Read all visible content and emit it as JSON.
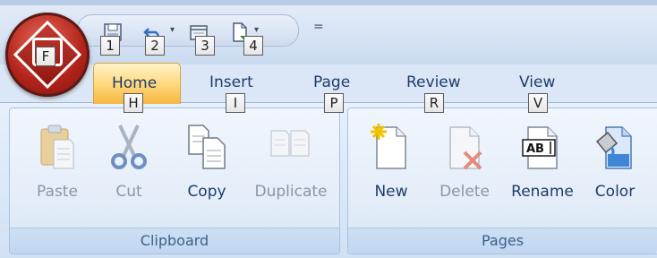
{
  "app_button": {
    "keytip": "F"
  },
  "quick_access": {
    "keytips": [
      "1",
      "2",
      "3",
      "4"
    ],
    "customize_glyph": "="
  },
  "tabs": [
    {
      "label": "Home",
      "keytip": "H"
    },
    {
      "label": "Insert",
      "keytip": "I"
    },
    {
      "label": "Page",
      "keytip": "P"
    },
    {
      "label": "Review",
      "keytip": "R"
    },
    {
      "label": "View",
      "keytip": "V"
    }
  ],
  "groups": {
    "clipboard": {
      "label": "Clipboard",
      "buttons": [
        {
          "label": "Paste",
          "icon": "paste-icon",
          "enabled": false
        },
        {
          "label": "Cut",
          "icon": "scissors-icon",
          "enabled": false
        },
        {
          "label": "Copy",
          "icon": "copy-icon",
          "enabled": true
        },
        {
          "label": "Duplicate",
          "icon": "duplicate-icon",
          "enabled": false
        }
      ]
    },
    "pages": {
      "label": "Pages",
      "buttons": [
        {
          "label": "New",
          "icon": "new-page-icon",
          "enabled": true
        },
        {
          "label": "Delete",
          "icon": "delete-page-icon",
          "enabled": false
        },
        {
          "label": "Rename",
          "icon": "rename-icon",
          "icon_text": "AB",
          "enabled": true
        },
        {
          "label": "Color",
          "icon": "color-fill-icon",
          "enabled": true
        }
      ]
    }
  },
  "colors": {
    "active_tab": "#ffd67a",
    "enabled_text": "#1e3c6a",
    "disabled_text": "#8a96a6",
    "app_orb": "#b3241b"
  }
}
